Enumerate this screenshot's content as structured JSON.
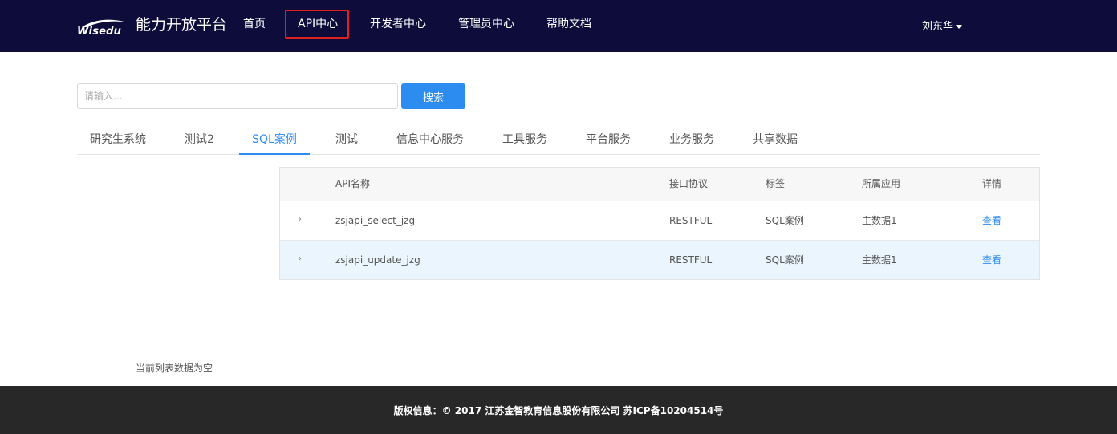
{
  "header": {
    "logo_text": "Wisedu",
    "brand": "能力开放平台",
    "nav": [
      {
        "label": "首页"
      },
      {
        "label": "API中心"
      },
      {
        "label": "开发者中心"
      },
      {
        "label": "管理员中心"
      },
      {
        "label": "帮助文档"
      }
    ],
    "active_nav": "API中心",
    "user_name": "刘东华"
  },
  "search": {
    "placeholder": "请输入...",
    "value": "",
    "button_label": "搜索"
  },
  "tabs": [
    {
      "label": "研究生系统"
    },
    {
      "label": "测试2"
    },
    {
      "label": "SQL案例"
    },
    {
      "label": "测试"
    },
    {
      "label": "信息中心服务"
    },
    {
      "label": "工具服务"
    },
    {
      "label": "平台服务"
    },
    {
      "label": "业务服务"
    },
    {
      "label": "共享数据"
    }
  ],
  "active_tab": "SQL案例",
  "table": {
    "headers": {
      "name": "API名称",
      "protocol": "接口协议",
      "tag": "标签",
      "app": "所属应用",
      "detail": "详情"
    },
    "rows": [
      {
        "expand": "›",
        "name": "zsjapi_select_jzg",
        "protocol": "RESTFUL",
        "tag": "SQL案例",
        "app": "主数据1",
        "detail": "查看"
      },
      {
        "expand": "›",
        "name": "zsjapi_update_jzg",
        "protocol": "RESTFUL",
        "tag": "SQL案例",
        "app": "主数据1",
        "detail": "查看"
      }
    ]
  },
  "empty_message": "当前列表数据为空",
  "footer": {
    "copyright": "版权信息：© 2017 江苏金智教育信息股份有限公司 苏ICP备10204514号"
  },
  "colors": {
    "header_bg": "#0e0c3b",
    "accent": "#2d8cf0",
    "active_nav_border": "#e0201f",
    "footer_bg": "#282828",
    "row_hover": "#eaf5fd"
  }
}
